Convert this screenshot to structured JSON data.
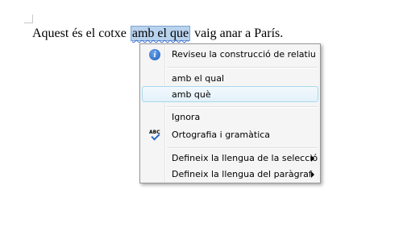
{
  "document": {
    "text_before": "Aquest és el cotxe ",
    "selected_text": "amb el que",
    "text_after": " vaig anar a París."
  },
  "context_menu": {
    "items": [
      {
        "label": "Reviseu la construcció de relatiu",
        "icon": "info-icon"
      },
      {
        "label": "amb el qual"
      },
      {
        "label": "amb què"
      },
      {
        "label": "Ignora"
      },
      {
        "label": "Ortografia i gramàtica",
        "icon": "spelling-grammar-icon"
      },
      {
        "label": "Defineix la llengua de la selecció",
        "submenu": true
      },
      {
        "label": "Defineix la llengua del paràgraf",
        "submenu": true
      }
    ],
    "hovered_index": 2
  },
  "icons": {
    "info_glyph": "i",
    "abc_glyph": "ABC"
  },
  "colors": {
    "selection": "#b9d3ee",
    "menu_background": "#f5f5f5",
    "hover_border": "#a8d8eb",
    "squiggle": "#3b6fd6"
  }
}
